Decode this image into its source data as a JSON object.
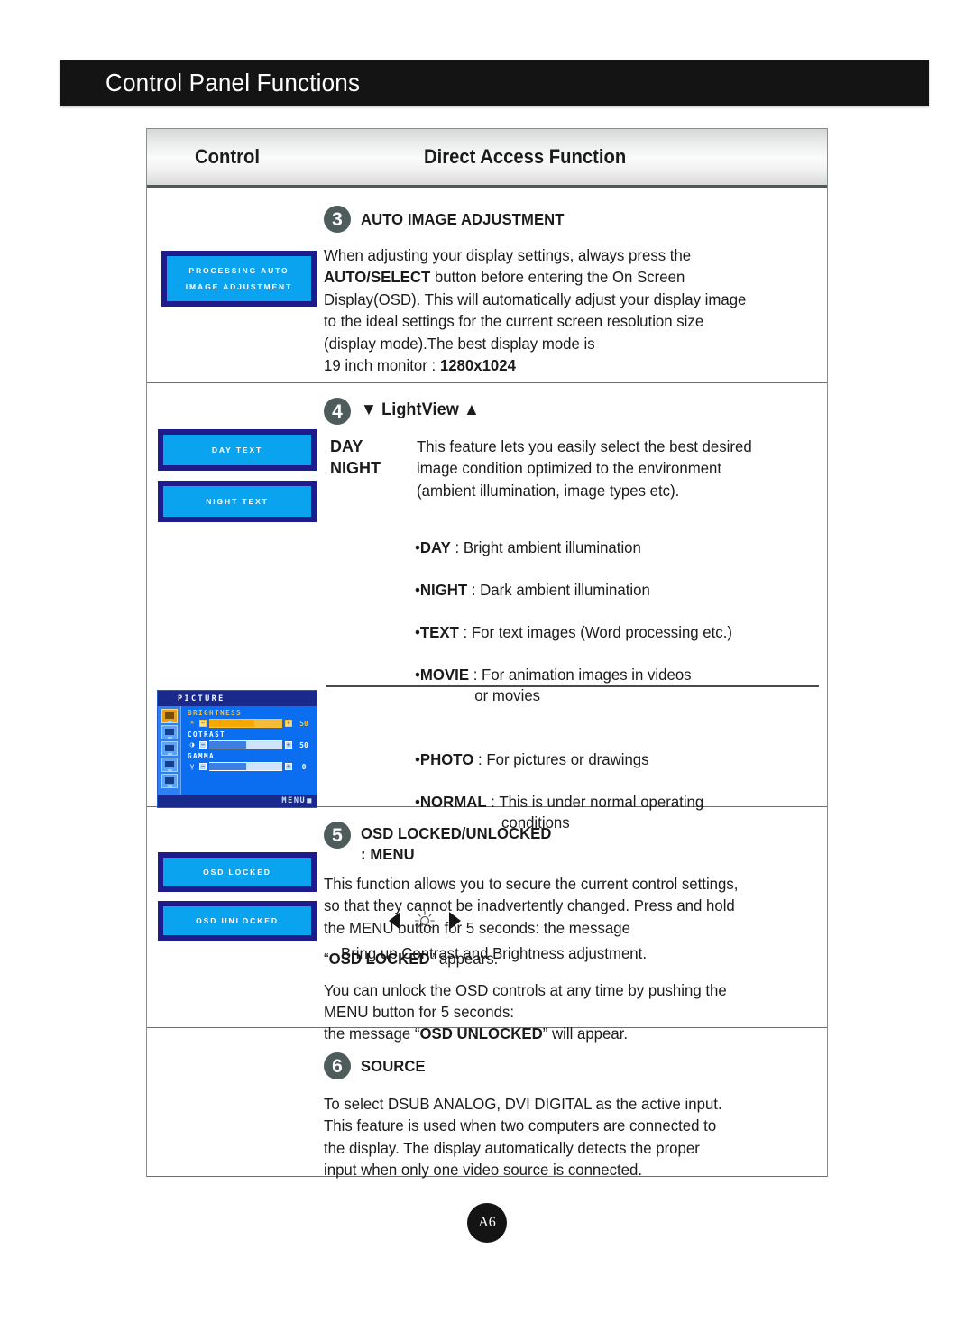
{
  "page": {
    "banner_title": "Control Panel Functions",
    "page_number": "A6"
  },
  "table": {
    "header": {
      "col1": "Control",
      "col2": "Direct Access Function"
    },
    "sections": [
      {
        "number": "3",
        "title": "AUTO IMAGE ADJUSTMENT",
        "osd_chip": {
          "line1": "PROCESSING AUTO",
          "line2": "IMAGE ADJUSTMENT"
        },
        "body_part1": "When adjusting your display settings, always press the\n",
        "body_bold1": "AUTO/SELECT",
        "body_part2": " button before entering the On Screen\nDisplay(OSD). This will automatically adjust your display image\nto the ideal settings for the current screen resolution size\n(display mode).The best display mode is\n19 inch monitor : ",
        "body_bold2": "1280x1024"
      },
      {
        "number": "4",
        "title": "LightView",
        "down_arrow": "▼",
        "up_arrow": "▲",
        "day_chip": "DAY TEXT",
        "night_chip": "NIGHT TEXT",
        "mode_label_1": "DAY",
        "mode_label_2": "NIGHT",
        "intro": "This feature lets you easily select the best desired\nimage condition optimized to the environment\n(ambient illumination, image types etc).",
        "bullets": [
          {
            "bullet": "•",
            "term": "DAY",
            "sep": " : ",
            "desc": "Bright ambient illumination",
            "cont": ""
          },
          {
            "bullet": "•",
            "term": "NIGHT",
            "sep": " : ",
            "desc": "Dark ambient illumination",
            "cont": ""
          },
          {
            "bullet": "•",
            "term": "TEXT",
            "sep": " : ",
            "desc": "For text images (Word processing etc.)",
            "cont": ""
          },
          {
            "bullet": "•",
            "term": "MOVIE",
            "sep": " : ",
            "desc": "For animation images in videos",
            "cont": "or movies"
          },
          {
            "bullet": "•",
            "term": "PHOTO",
            "sep": " : ",
            "desc": "For pictures or drawings",
            "cont": ""
          },
          {
            "bullet": "•",
            "term": "NORMAL",
            "sep": " : ",
            "desc": "This is under normal operating",
            "cont": "conditions"
          }
        ],
        "contrast_text": "Bring up Contrast and Brightness adjustment.",
        "osd_menu": {
          "title": "PICTURE",
          "footer": "MENU",
          "fields": [
            {
              "label": "BRIGHTNESS",
              "glyph": "☀",
              "minus": "−",
              "plus": "+",
              "value": "50",
              "fill_pct": 62,
              "highlight": true
            },
            {
              "label": "COTRAST",
              "glyph": "◑",
              "minus": "−",
              "plus": "+",
              "value": "50",
              "fill_pct": 50,
              "highlight": false
            },
            {
              "label": "GAMMA",
              "glyph": "γ",
              "minus": "−",
              "plus": "+",
              "value": "0",
              "fill_pct": 50,
              "highlight": false
            }
          ]
        }
      },
      {
        "number": "5",
        "title_line1": "OSD LOCKED/UNLOCKED",
        "title_line2": ": MENU",
        "locked_chip": "OSD LOCKED",
        "unlocked_chip": "OSD UNLOCKED",
        "para1": "This function allows you to secure the current control settings,\nso that they cannot be inadvertently changed. Press and hold\nthe MENU button for 5 seconds: the message",
        "para2_pre": "“",
        "para2_bold": "OSD LOCKED",
        "para2_post": "” appears.",
        "para3_a": "You can unlock the OSD controls at any time by pushing the\nMENU button for 5 seconds:\nthe message “",
        "para3_bold": "OSD UNLOCKED",
        "para3_b": "” will appear."
      },
      {
        "number": "6",
        "title": "SOURCE",
        "body": "To select DSUB ANALOG, DVI DIGITAL as the active input.\nThis feature is used when two computers are connected to\nthe display. The display automatically detects the proper\ninput when only one video source is connected."
      }
    ]
  },
  "colors": {
    "banner_bg": "#141414",
    "chip_border": "#1e1b8c",
    "chip_fill": "#0aa3f0",
    "circle_num": "#4e5c5c",
    "osd_bg": "#0b6ef0",
    "osd_title_bar": "#1a2a8c",
    "osd_amber": "#ffc22e"
  }
}
